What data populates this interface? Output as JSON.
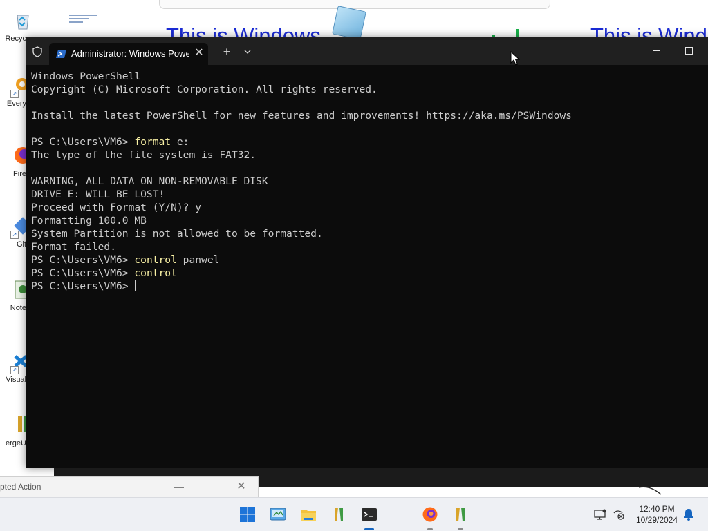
{
  "desktop": {
    "background_text": "This is Windows",
    "background_text_right": "This is Wind",
    "icons": [
      {
        "label": "Recyc",
        "icon": "recycle-bin-icon"
      },
      {
        "label": "Every",
        "icon": "everything-search-icon"
      },
      {
        "label": "Fire",
        "icon": "firefox-icon"
      },
      {
        "label": "Git",
        "icon": "git-icon"
      },
      {
        "label": "Note",
        "icon": "notepad-icon"
      },
      {
        "label": "Visual",
        "icon": "vscode-icon"
      },
      {
        "label": "ergeU",
        "icon": "winmerge-icon"
      }
    ]
  },
  "terminal": {
    "tab_title": "Administrator: Windows PowerShell",
    "lines": [
      {
        "text": "Windows PowerShell"
      },
      {
        "text": "Copyright (C) Microsoft Corporation. All rights reserved."
      },
      {
        "text": ""
      },
      {
        "text": "Install the latest PowerShell for new features and improvements! https://aka.ms/PSWindows"
      },
      {
        "text": ""
      },
      {
        "prompt": "PS C:\\Users\\VM6> ",
        "cmd": "format",
        "args": " e:"
      },
      {
        "text": "The type of the file system is FAT32."
      },
      {
        "text": ""
      },
      {
        "text": "WARNING, ALL DATA ON NON-REMOVABLE DISK"
      },
      {
        "text": "DRIVE E: WILL BE LOST!"
      },
      {
        "text": "Proceed with Format (Y/N)? y"
      },
      {
        "text": "Formatting 100.0 MB"
      },
      {
        "text": "System Partition is not allowed to be formatted."
      },
      {
        "text": "Format failed."
      },
      {
        "prompt": "PS C:\\Users\\VM6> ",
        "cmd": "control",
        "args": " panwel"
      },
      {
        "prompt": "PS C:\\Users\\VM6> ",
        "cmd": "control",
        "args": ""
      },
      {
        "prompt": "PS C:\\Users\\VM6> ",
        "cmd": "",
        "args": "",
        "cursor": true
      }
    ]
  },
  "partial_window": {
    "title": "pted Action"
  },
  "taskbar": {
    "apps": [
      {
        "name": "start-button",
        "icon": "windows-start-icon",
        "active": false,
        "running": false
      },
      {
        "name": "control-panel-button",
        "icon": "control-panel-icon",
        "active": false,
        "running": false
      },
      {
        "name": "file-explorer-button",
        "icon": "folder-icon",
        "active": false,
        "running": false
      },
      {
        "name": "winmerge-button",
        "icon": "winmerge-icon",
        "active": false,
        "running": false
      },
      {
        "name": "terminal-button",
        "icon": "terminal-icon",
        "active": true,
        "running": true
      },
      {
        "name": "firefox-button",
        "icon": "firefox-icon",
        "active": false,
        "running": true
      },
      {
        "name": "winmerge-2-button",
        "icon": "winmerge-icon",
        "active": false,
        "running": true
      }
    ],
    "time": "12:40 PM",
    "date": "10/29/2024"
  },
  "colors": {
    "terminal_bg": "#0c0c0c",
    "titlebar_bg": "#202020",
    "command_yellow": "#f9f1a5",
    "text_gray": "#cccccc",
    "desktop_text_blue": "#1a2bd6",
    "active_indicator": "#1565c0"
  }
}
